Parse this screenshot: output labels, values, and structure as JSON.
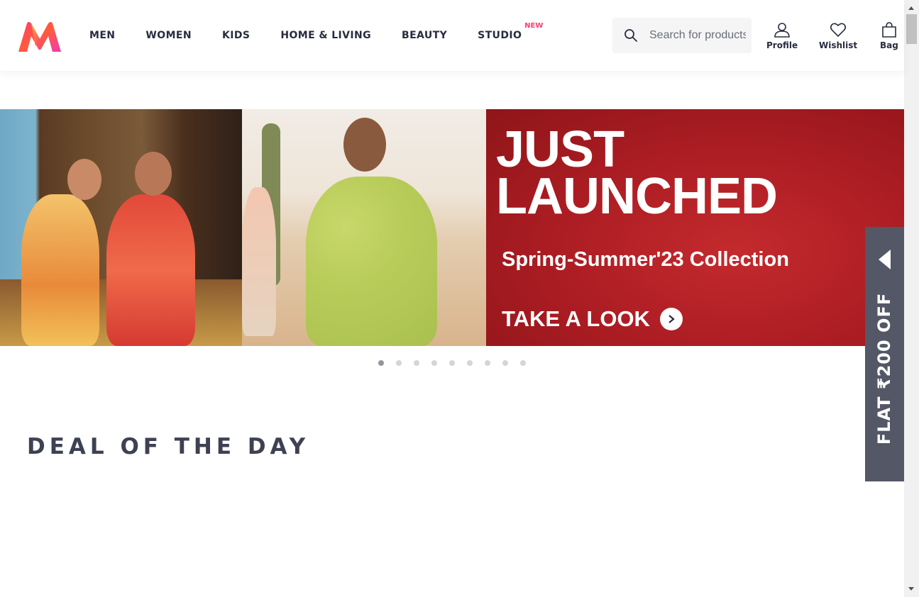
{
  "header": {
    "nav": [
      {
        "label": "MEN"
      },
      {
        "label": "WOMEN"
      },
      {
        "label": "KIDS"
      },
      {
        "label": "HOME & LIVING"
      },
      {
        "label": "BEAUTY"
      },
      {
        "label": "STUDIO",
        "badge": "NEW"
      }
    ],
    "search": {
      "placeholder": "Search for products, brands and more"
    },
    "actions": {
      "profile": "Profile",
      "wishlist": "Wishlist",
      "bag": "Bag"
    }
  },
  "banner": {
    "title_line1": "JUST",
    "title_line2": "LAUNCHED",
    "subtitle": "Spring-Summer'23 Collection",
    "cta": "TAKE A LOOK",
    "slide_count": 9,
    "active_slide": 1
  },
  "deal": {
    "title": "DEAL OF THE DAY"
  },
  "side_offer": {
    "label": "FLAT ₹200 OFF"
  },
  "colors": {
    "brand_pink": "#ff3f6c",
    "banner_red": "#a91c22",
    "side_tab": "#535766"
  }
}
